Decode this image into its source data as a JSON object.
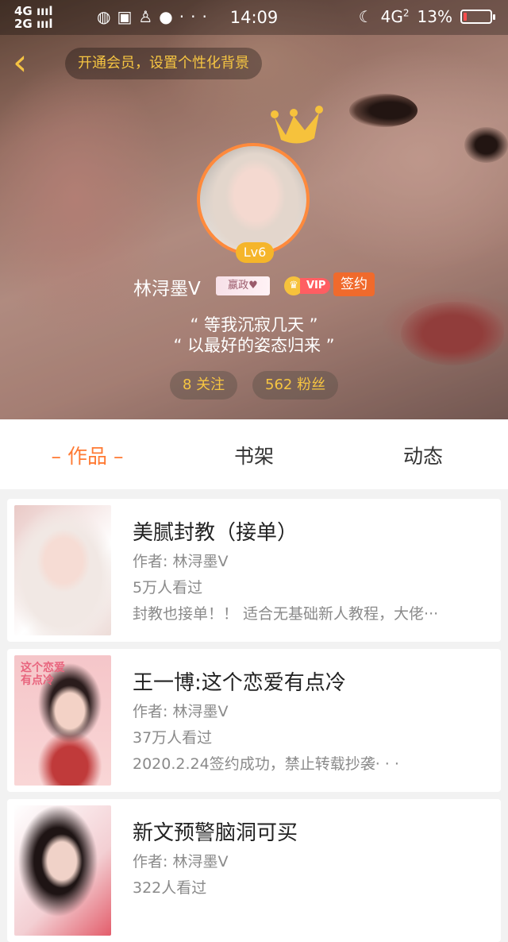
{
  "status_bar": {
    "network_top": "4G",
    "network_bottom": "2G",
    "time": "14:09",
    "network_right": "4G",
    "network_right_sup": "2",
    "battery": "13%",
    "battery_level": 0.13,
    "icons": [
      "globe-icon",
      "browser-icon",
      "penguin-icon",
      "chat-icon",
      "more-icon",
      "moon-icon"
    ]
  },
  "header": {
    "vip_tip": "开通会员，设置个性化背景",
    "level": "Lv6",
    "name": "林浔墨V",
    "name_tag": "嬴政♥",
    "vip_label": "VIP",
    "sign_label": "签约",
    "motto_line1": "“ 等我沉寂几天 ”",
    "motto_line2": "“ 以最好的姿态归来 ”",
    "following": "8 关注",
    "fans": "562 粉丝"
  },
  "tabs": [
    {
      "label": "– 作品 –",
      "active": true
    },
    {
      "label": "书架",
      "active": false
    },
    {
      "label": "动态",
      "active": false
    }
  ],
  "books": [
    {
      "title": "美腻封教（接单）",
      "author": "作者: 林浔墨V",
      "views": "5万人看过",
      "desc": "封教也接单！！ 适合无基础新人教程，大佬···"
    },
    {
      "title": "王一博:这个恋爱有点冷",
      "author": "作者: 林浔墨V",
      "views": "37万人看过",
      "desc": "2020.2.24签约成功，禁止转载抄袭· · ·",
      "cover_text": "这个恋爱有点冷"
    },
    {
      "title": "新文预警脑洞可买",
      "author": "作者: 林浔墨V",
      "views": "322人看过",
      "desc": ""
    }
  ],
  "colors": {
    "accent": "#ff7a33",
    "gold": "#f6c542",
    "sign": "#f06a2c",
    "vip": "#ff5e62",
    "avatar_border": "#ff8a3c"
  }
}
